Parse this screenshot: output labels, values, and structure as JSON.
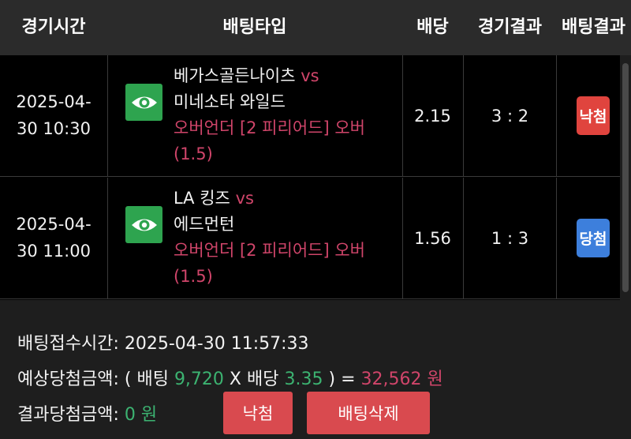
{
  "header": {
    "col_time": "경기시간",
    "col_bet_type": "배팅타입",
    "col_odds": "배당",
    "col_game_result": "경기결과",
    "col_bet_result": "배팅결과"
  },
  "rows": [
    {
      "date": "2025-04-",
      "time": "30 10:30",
      "home": "베가스골든나이츠",
      "vs": "vs",
      "away": "미네소타 와일드",
      "market_line1": "오버언더 [2 피리어드] 오버",
      "market_line2": "(1.5)",
      "odds": "2.15",
      "score": "3 : 2",
      "result": "낙첨",
      "icon": "eye-icon"
    },
    {
      "date": "2025-04-",
      "time": "30 11:00",
      "home": "LA 킹즈",
      "vs": "vs",
      "away": "에드먼턴",
      "market_line1": "오버언더 [2 피리어드] 오버",
      "market_line2": "(1.5)",
      "odds": "1.56",
      "score": "1 : 3",
      "result": "당첨",
      "icon": "eye-icon"
    }
  ],
  "summary": {
    "accept_label": "배팅접수시간:",
    "accept_time": "2025-04-30 11:57:33",
    "expected_label": "예상당첨금액:",
    "open_paren": "(",
    "bet_label": "배팅",
    "bet_amount": "9,720",
    "times": "X",
    "odds_label": "배당",
    "total_odds": "3.35",
    "close_paren": ")",
    "equals": "=",
    "expected_amount": "32,562",
    "won": "원",
    "result_label": "결과당첨금액:",
    "result_amount": "0",
    "result_won": "원"
  },
  "actions": {
    "lose_label": "낙첨",
    "delete_label": "배팅삭제"
  },
  "colors": {
    "header_bg": "#2b2b2b",
    "body_bg": "#000000",
    "accent_pink": "#d0456a",
    "accent_green": "#3cb371",
    "lose_red": "#e0443e",
    "win_blue": "#3d7fdc",
    "eye_button_green": "#2ea44f",
    "action_button_red": "#d94a4f"
  }
}
